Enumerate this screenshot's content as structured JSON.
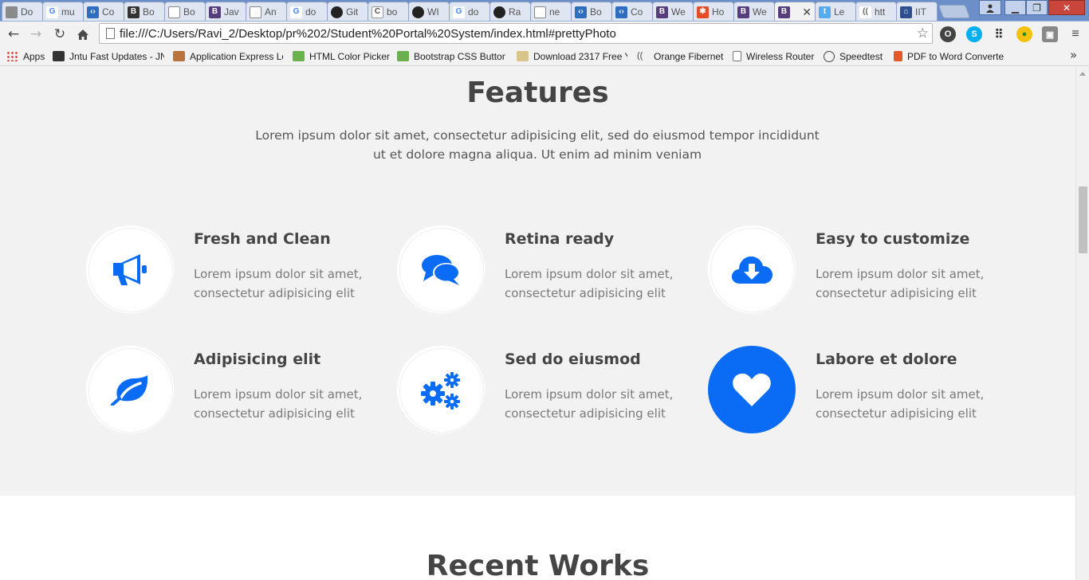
{
  "browser": {
    "tabs": [
      {
        "label": "Do",
        "icon": "document-icon",
        "color": "#8a8a8a"
      },
      {
        "label": "mu",
        "icon": "google-icon",
        "color": "#4285f4"
      },
      {
        "label": "Co",
        "icon": "bootply-icon",
        "color": "#2f6ebf"
      },
      {
        "label": "Bo",
        "icon": "bootstrap-b-icon",
        "color": "#333333"
      },
      {
        "label": "Bo",
        "icon": "document-icon",
        "color": "#8a8a8a"
      },
      {
        "label": "Jav",
        "icon": "bootstrap-icon",
        "color": "#563d7c"
      },
      {
        "label": "An",
        "icon": "document-icon",
        "color": "#8a8a8a"
      },
      {
        "label": "do",
        "icon": "google-icon",
        "color": "#4285f4"
      },
      {
        "label": "Git",
        "icon": "github-icon",
        "color": "#222222"
      },
      {
        "label": "bo",
        "icon": "c-icon",
        "color": "#555555"
      },
      {
        "label": "WI",
        "icon": "github-icon",
        "color": "#222222"
      },
      {
        "label": "do",
        "icon": "google-icon",
        "color": "#4285f4"
      },
      {
        "label": "Ra",
        "icon": "github-icon",
        "color": "#222222"
      },
      {
        "label": "ne",
        "icon": "document-icon",
        "color": "#8a8a8a"
      },
      {
        "label": "Bo",
        "icon": "bootply-icon",
        "color": "#2f6ebf"
      },
      {
        "label": "Co",
        "icon": "bootply-icon",
        "color": "#2f6ebf"
      },
      {
        "label": "We",
        "icon": "bootstrap-icon",
        "color": "#563d7c"
      },
      {
        "label": "Ho",
        "icon": "joomla-icon",
        "color": "#e44d26"
      },
      {
        "label": "We",
        "icon": "bootstrap-icon",
        "color": "#563d7c"
      },
      {
        "label": "",
        "icon": "bootstrap-icon",
        "color": "#563d7c",
        "active": true
      },
      {
        "label": "Le",
        "icon": "twitter-icon",
        "color": "#55acee"
      },
      {
        "label": "htt",
        "icon": "signal-icon",
        "color": "#666666"
      },
      {
        "label": "IIT",
        "icon": "iit-logo-icon",
        "color": "#2d4f8f"
      }
    ],
    "url": "file:///C:/Users/Ravi_2/Desktop/pr%202/Student%20Portal%20System/index.html#prettyPhoto",
    "bookmarks": [
      {
        "label": "Apps",
        "icon": "apps-grid-icon"
      },
      {
        "label": "Jntu Fast Updates - JN",
        "icon": "graduation-cap-icon"
      },
      {
        "label": "Application Express Lo",
        "icon": "chart-icon"
      },
      {
        "label": "HTML Color Picker",
        "icon": "w3schools-icon"
      },
      {
        "label": "Bootstrap CSS Button",
        "icon": "w3schools-icon"
      },
      {
        "label": "Download 2317 Free Y",
        "icon": "folder-icon"
      },
      {
        "label": "Orange Fibernet",
        "icon": "signal-icon"
      },
      {
        "label": "Wireless Router",
        "icon": "document-icon"
      },
      {
        "label": "Speedtest",
        "icon": "speedometer-icon"
      },
      {
        "label": "PDF to Word Converte",
        "icon": "pdf-icon"
      }
    ]
  },
  "features": {
    "title": "Features",
    "lead": "Lorem ipsum dolor sit amet, consectetur adipisicing elit, sed do eiusmod tempor incididunt ut et dolore magna aliqua. Ut enim ad minim veniam",
    "items": [
      {
        "title": "Fresh and Clean",
        "text": "Lorem ipsum dolor sit amet, consectetur adipisicing elit",
        "icon": "megaphone-icon"
      },
      {
        "title": "Retina ready",
        "text": "Lorem ipsum dolor sit amet, consectetur adipisicing elit",
        "icon": "comments-icon"
      },
      {
        "title": "Easy to customize",
        "text": "Lorem ipsum dolor sit amet, consectetur adipisicing elit",
        "icon": "cloud-download-icon"
      },
      {
        "title": "Adipisicing elit",
        "text": "Lorem ipsum dolor sit amet, consectetur adipisicing elit",
        "icon": "leaf-icon"
      },
      {
        "title": "Sed do eiusmod",
        "text": "Lorem ipsum dolor sit amet, consectetur adipisicing elit",
        "icon": "cogs-icon"
      },
      {
        "title": "Labore et dolore",
        "text": "Lorem ipsum dolor sit amet, consectetur adipisicing elit",
        "icon": "heart-icon"
      }
    ],
    "accent_color": "#0a6cf5"
  },
  "recent_works": {
    "title": "Recent Works"
  }
}
